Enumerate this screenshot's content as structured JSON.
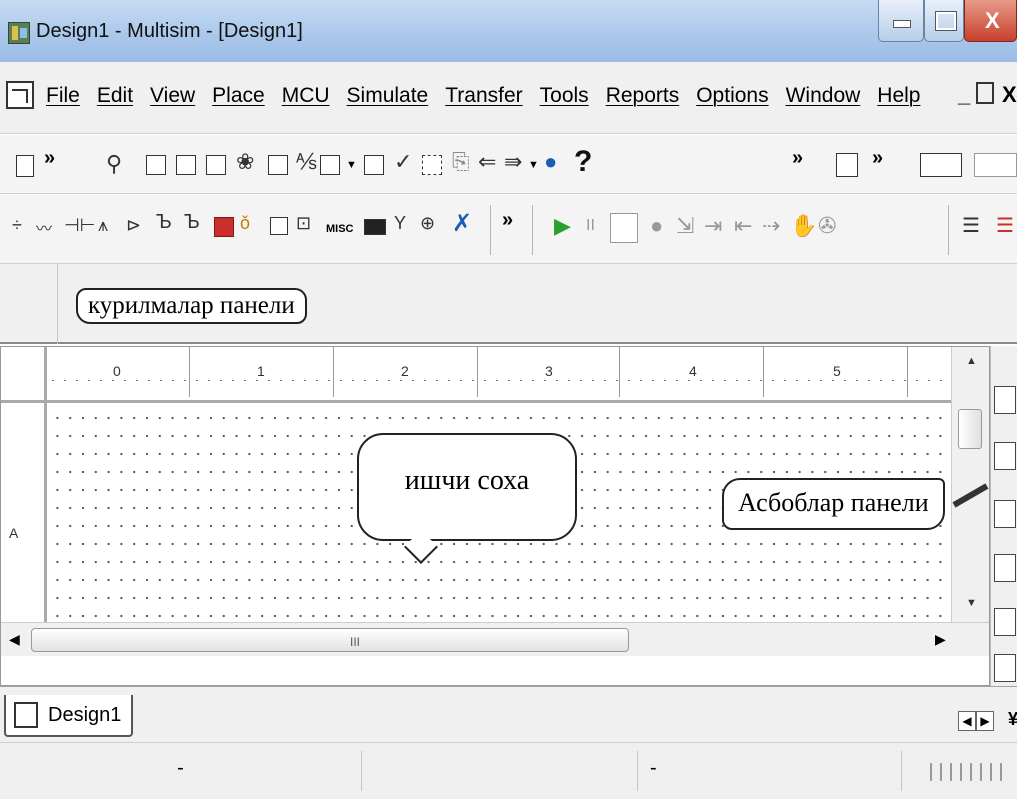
{
  "window": {
    "title": "Design1 - Multisim - [Design1]",
    "close_glyph": "X"
  },
  "menu": {
    "items": [
      "File",
      "Edit",
      "View",
      "Place",
      "MCU",
      "Simulate",
      "Transfer",
      "Tools",
      "Reports",
      "Options",
      "Window",
      "Help"
    ],
    "mdi_minimize": "_",
    "mdi_close": "X"
  },
  "toolbar1": {
    "overflow_glyph": "»",
    "help_glyph": "?"
  },
  "toolbar2": {
    "misc_label": "MISC",
    "overflow_glyph": "»",
    "run_glyph": "▶",
    "pause_glyph": "II"
  },
  "annotations": {
    "devices_panel": "курилмалар панели",
    "workspace": "ишчи соха",
    "instruments_panel": "Асбоблар панели"
  },
  "ruler": {
    "columns": [
      "0",
      "1",
      "2",
      "3",
      "4",
      "5"
    ],
    "row_label": "A"
  },
  "scrollbar": {
    "grip_glyph": "III"
  },
  "tabs": {
    "items": [
      "Design1"
    ],
    "nav_left": "◀",
    "nav_right": "▶",
    "more_glyph": "¥"
  },
  "status": {
    "cell1": "-",
    "cell2": "",
    "cell3": "-"
  },
  "colors": {
    "titlebar": "#a9c6ea",
    "close_button": "#c7402b",
    "run_green": "#2ca02c"
  }
}
